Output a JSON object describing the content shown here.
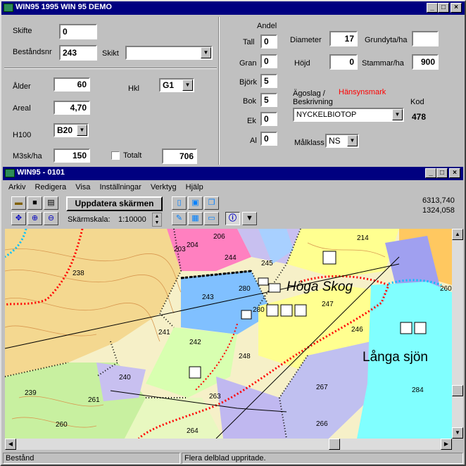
{
  "main_window": {
    "title": "WIN95 1995 WIN 95 DEMO",
    "caption_buttons": [
      "_",
      "□",
      "×"
    ]
  },
  "form": {
    "skifte_label": "Skifte",
    "skifte_value": "0",
    "bestandsnr_label": "Beståndsnr",
    "bestandsnr_value": "243",
    "skikt_label": "Skikt",
    "skikt_value": "",
    "alder_label": "Ålder",
    "alder_value": "60",
    "hkl_label": "Hkl",
    "hkl_value": "G1",
    "areal_label": "Areal",
    "areal_value": "4,70",
    "h100_label": "H100",
    "h100_value": "B20",
    "m3sk_label": "M3sk/ha",
    "m3sk_value": "150",
    "totalt_label": "Totalt",
    "totalt_value": "706",
    "andel_label": "Andel",
    "species": [
      {
        "label": "Tall",
        "value": "0"
      },
      {
        "label": "Gran",
        "value": "0"
      },
      {
        "label": "Björk",
        "value": "5"
      },
      {
        "label": "Bok",
        "value": "5"
      },
      {
        "label": "Ek",
        "value": "0"
      },
      {
        "label": "Al",
        "value": "0"
      }
    ],
    "diameter_label": "Diameter",
    "diameter_value": "17",
    "grundyta_label": "Grundyta/ha",
    "grundyta_value": "",
    "hojd_label": "Höjd",
    "hojd_value": "0",
    "stammar_label": "Stammar/ha",
    "stammar_value": "900",
    "agoslag_label_1": "Ägoslag /",
    "agoslag_label_2": "Beskrivning",
    "hansyn_label": "Hänsynsmark",
    "kod_label": "Kod",
    "kod_value": "478",
    "beskrivning_value": "NYCKELBIOTOP",
    "malklass_label": "Målklass",
    "malklass_value": "NS"
  },
  "map_window": {
    "title": "WIN95 - 0101",
    "menu": [
      "Arkiv",
      "Redigera",
      "Visa",
      "Inställningar",
      "Verktyg",
      "Hjälp"
    ],
    "update_button": "Uppdatera skärmen",
    "scale_label": "Skärmskala:",
    "scale_value": "1:10000",
    "coord_1": "6313,740",
    "coord_2": "1324,058",
    "map_labels": {
      "hoga_skog": "Höga Skog",
      "langa_sjon": "Långa sjön",
      "stands": [
        "203",
        "206",
        "204",
        "214",
        "244",
        "245",
        "238",
        "280",
        "243",
        "247",
        "260",
        "280",
        "241",
        "246",
        "242",
        "248",
        "240",
        "239",
        "267",
        "284",
        "261",
        "263",
        "260",
        "264",
        "266"
      ]
    },
    "status_left": "Bestånd",
    "status_right": "Flera delblad uppritade."
  },
  "colors": {
    "titlebar": "#000080",
    "face": "#c0c0c0",
    "hansyn": "#ff0000",
    "lake": "#80ffff"
  }
}
